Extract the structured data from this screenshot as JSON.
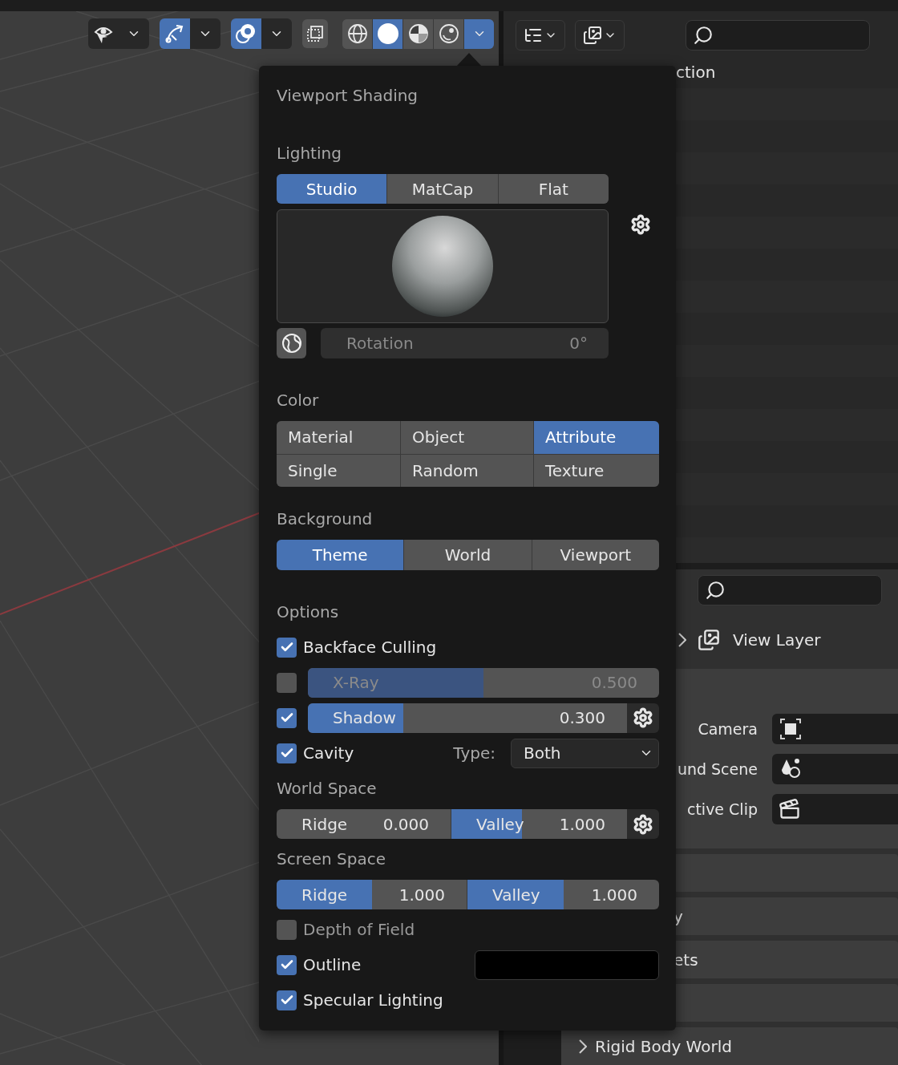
{
  "viewport_header": {
    "toggles": [
      {
        "kind": "select",
        "on": false
      },
      {
        "kind": "gizmo",
        "on": true
      },
      {
        "kind": "overlays",
        "on": true
      }
    ],
    "xray": {
      "on": false
    },
    "shading_modes": [
      {
        "kind": "wireframe",
        "selected": false
      },
      {
        "kind": "solid",
        "selected": true
      },
      {
        "kind": "material",
        "selected": false
      },
      {
        "kind": "rendered",
        "selected": false
      }
    ],
    "shading_menu": {
      "open": true
    }
  },
  "popup": {
    "title": "Viewport Shading",
    "lighting": {
      "label": "Lighting",
      "modes": [
        {
          "label": "Studio",
          "selected": true
        },
        {
          "label": "MatCap",
          "selected": false
        },
        {
          "label": "Flat",
          "selected": false
        }
      ],
      "rotation": {
        "label": "Rotation",
        "value": "0°",
        "disabled": true
      }
    },
    "color": {
      "label": "Color",
      "options": [
        {
          "label": "Material",
          "selected": false
        },
        {
          "label": "Object",
          "selected": false
        },
        {
          "label": "Attribute",
          "selected": true
        },
        {
          "label": "Single",
          "selected": false
        },
        {
          "label": "Random",
          "selected": false
        },
        {
          "label": "Texture",
          "selected": false
        }
      ]
    },
    "background": {
      "label": "Background",
      "options": [
        {
          "label": "Theme",
          "selected": true
        },
        {
          "label": "World",
          "selected": false
        },
        {
          "label": "Viewport",
          "selected": false
        }
      ]
    },
    "options": {
      "label": "Options",
      "items": [
        {
          "kind": "checkbox",
          "label": "Backface Culling",
          "checked": true
        },
        {
          "kind": "slider",
          "label": "X-Ray",
          "checked": false,
          "level": 0.5,
          "value": "0.500",
          "settings": false
        },
        {
          "kind": "slider",
          "label": "Shadow",
          "checked": true,
          "level": 0.3,
          "value": "0.300",
          "settings": true
        },
        {
          "kind": "cavity",
          "label": "Cavity",
          "checked": true,
          "type_label": "Type:",
          "type_value": "Both"
        }
      ]
    },
    "world_space": {
      "label": "World Space",
      "settings": true,
      "fields": [
        {
          "label": "Ridge",
          "value": "0.000",
          "level": 0
        },
        {
          "label": "Valley",
          "value": "1.000",
          "level": 0.4
        }
      ]
    },
    "screen_space": {
      "label": "Screen Space",
      "settings": false,
      "fields": [
        {
          "label": "Ridge",
          "value": "1.000",
          "level": 0.5
        },
        {
          "label": "Valley",
          "value": "1.000",
          "level": 0.5
        }
      ]
    },
    "more_options": [
      {
        "kind": "checkbox",
        "label": "Depth of Field",
        "checked": false
      },
      {
        "kind": "color",
        "label": "Outline",
        "checked": true,
        "color": "#000000"
      },
      {
        "kind": "checkbox",
        "label": "Specular Lighting",
        "checked": true
      }
    ]
  },
  "outliner": {
    "rows": [
      {
        "label": "ction"
      }
    ]
  },
  "properties": {
    "view_layer": {
      "label": "View Layer",
      "expanded": false
    },
    "fields": [
      {
        "kind": "camera",
        "label": "Camera"
      },
      {
        "kind": "scene",
        "label": "und Scene"
      },
      {
        "kind": "clip",
        "label": "ctive Clip"
      }
    ],
    "panels": [
      {
        "kind": "header"
      },
      {
        "kind": "header",
        "label": "y"
      },
      {
        "kind": "header",
        "label": "ets"
      },
      {
        "kind": "header"
      },
      {
        "kind": "subpanel",
        "label": "Rigid Body World",
        "expanded": false
      }
    ]
  }
}
